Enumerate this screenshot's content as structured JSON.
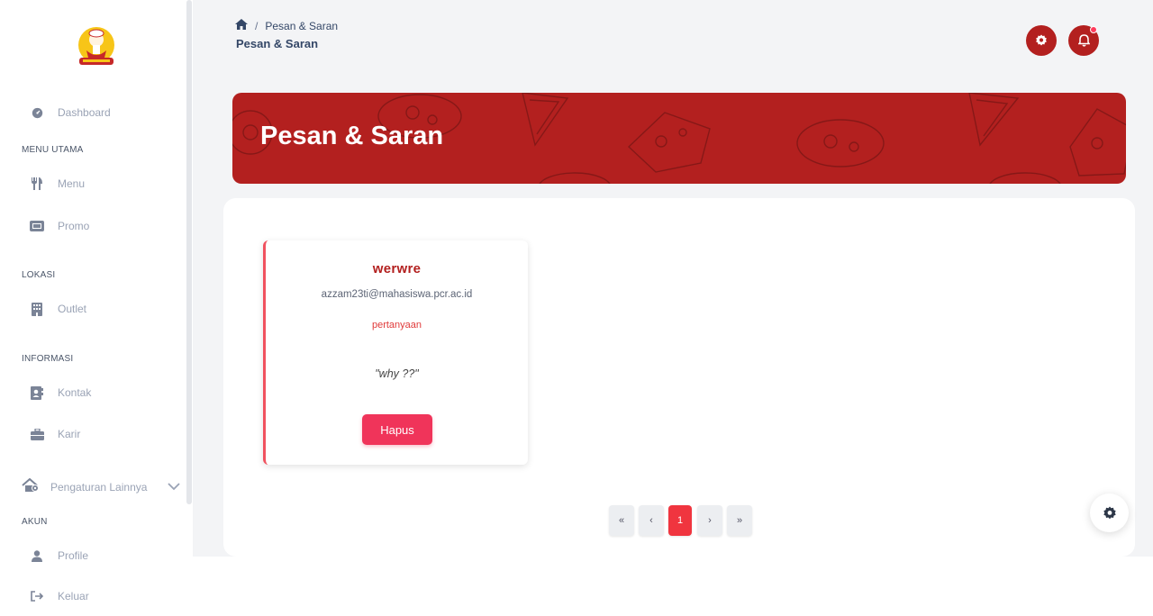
{
  "sidebar": {
    "dashboard": "Dashboard",
    "sections": {
      "menu_utama": "MENU UTAMA",
      "lokasi": "LOKASI",
      "informasi": "INFORMASI",
      "akun": "AKUN"
    },
    "items": {
      "menu": "Menu",
      "promo": "Promo",
      "outlet": "Outlet",
      "kontak": "Kontak",
      "karir": "Karir",
      "pengaturan": "Pengaturan Lainnya",
      "profile": "Profile",
      "keluar": "Keluar"
    }
  },
  "header": {
    "breadcrumb_current": "Pesan & Saran",
    "page_title": "Pesan & Saran",
    "accent_color": "#b3201f"
  },
  "banner": {
    "title": "Pesan & Saran"
  },
  "messages": [
    {
      "name": "werwre",
      "email": "azzam23ti@mahasiswa.pcr.ac.id",
      "category": "pertanyaan",
      "text": "\"why ??\"",
      "delete_label": "Hapus"
    }
  ],
  "pagination": {
    "first": "«",
    "prev": "‹",
    "current": "1",
    "next": "›",
    "last": "»"
  }
}
